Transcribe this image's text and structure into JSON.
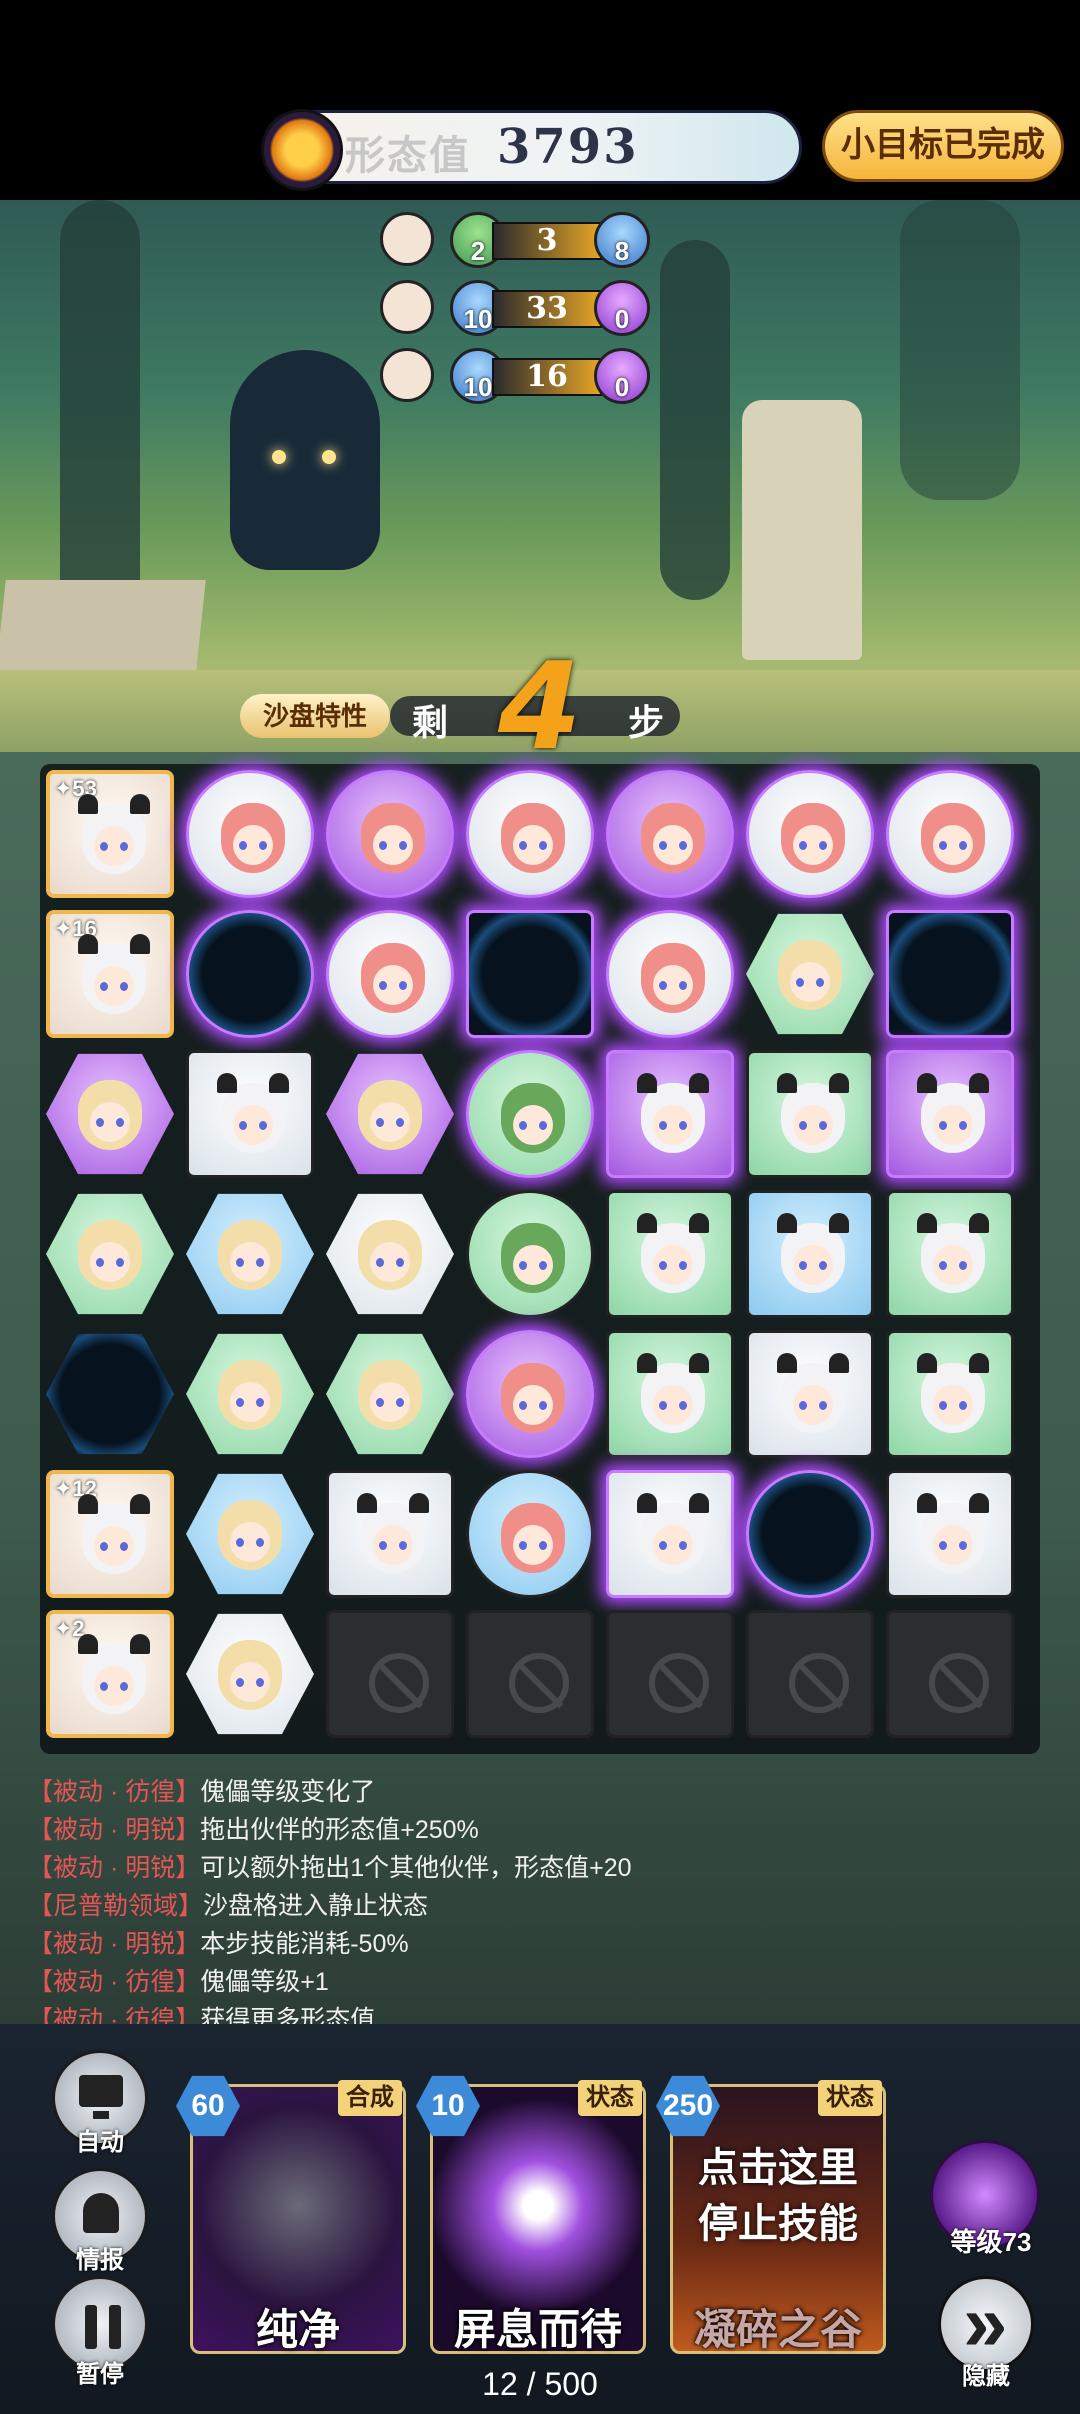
{
  "header": {
    "score_label": "形态值",
    "score_value": "3793",
    "goal_button": "小目标已完成"
  },
  "stats": [
    {
      "left": "2",
      "middle": "3",
      "right": "8"
    },
    {
      "left": "10",
      "middle": "33",
      "right": "0"
    },
    {
      "left": "10",
      "middle": "16",
      "right": "0"
    }
  ],
  "banner": {
    "tag": "沙盘特性",
    "left": "剩",
    "steps": "4",
    "right": "步"
  },
  "board": {
    "badges": [
      "53",
      "16",
      "12",
      "2"
    ]
  },
  "log": [
    {
      "tag": "【被动 · 彷徨】",
      "text": "傀儡等级变化了"
    },
    {
      "tag": "【被动 · 明锐】",
      "text": "拖出伙伴的形态值+250%"
    },
    {
      "tag": "【被动 · 明锐】",
      "text": "可以额外拖出1个其他伙伴，形态值+20"
    },
    {
      "tag": "【尼普勒领域】",
      "text": "沙盘格进入静止状态"
    },
    {
      "tag": "【被动 · 明锐】",
      "text": "本步技能消耗-50%"
    },
    {
      "tag": "【被动 · 彷徨】",
      "text": "傀儡等级+1"
    },
    {
      "tag": "【被动 · 彷徨】",
      "text": "获得更多形态值"
    }
  ],
  "side_buttons": {
    "auto": "自动",
    "intel": "情报",
    "pause": "暂停"
  },
  "cards": [
    {
      "cost": "60",
      "type": "合成",
      "name": "纯净",
      "middle": ""
    },
    {
      "cost": "10",
      "type": "状态",
      "name": "屏息而待",
      "middle": ""
    },
    {
      "cost": "250",
      "type": "状态",
      "name": "凝碎之谷",
      "middle": "点击这里\n停止技能"
    }
  ],
  "level": {
    "label": "等级73"
  },
  "hide": {
    "label": "隐藏"
  },
  "progress": "12 / 500",
  "colors": {
    "accent": "#b04cff",
    "gold": "#f0b74a",
    "log_tag": "#e45555"
  }
}
